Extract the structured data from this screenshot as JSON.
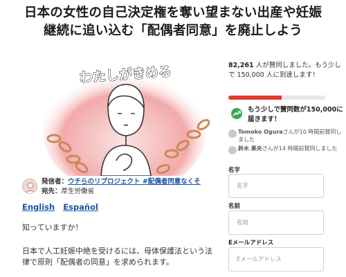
{
  "petition": {
    "title_line1": "日本の女性の自己決定権を奪い望まない出産や妊娠",
    "title_line2": "継続に追い込む「配偶者同意」を廃止しよう",
    "hero_caption": "わたしがきめる"
  },
  "sender": {
    "from_label": "発信者：",
    "from_name": "ウチらのリプロジェクト #配偶者同意なくそ",
    "to_label": "宛先：",
    "to_name": "厚生労働省"
  },
  "languages": [
    "English",
    "Español"
  ],
  "body": {
    "p1": "知っていますか！",
    "p2": "日本で人工妊娠中絶を受けるには、母体保護法という法律で原則「配偶者の同意」を求められます。"
  },
  "signatures": {
    "count": "82,261",
    "count_text": " 人が賛同しました。もう少しで 150,000 人に到達します！",
    "goal": 150000,
    "progress": 0.548,
    "cta": "もう少しで賛同数が150,000に届きます！"
  },
  "recent_signers": [
    {
      "name": "Tomoko Ogura",
      "action": "さんが10 時間前賛同しました"
    },
    {
      "name": "鈴木 果央",
      "action": "さんが14 時間前賛同しました"
    }
  ],
  "form": {
    "first_name_label": "名字",
    "first_name_placeholder": "名字",
    "last_name_label": "名前",
    "last_name_placeholder": "名前",
    "email_label": "Eメールアドレス",
    "email_placeholder": "Eメールアドレス"
  },
  "colors": {
    "accent": "#e23b2a",
    "link": "#1a55a3",
    "cta_icon": "#39a84c"
  }
}
